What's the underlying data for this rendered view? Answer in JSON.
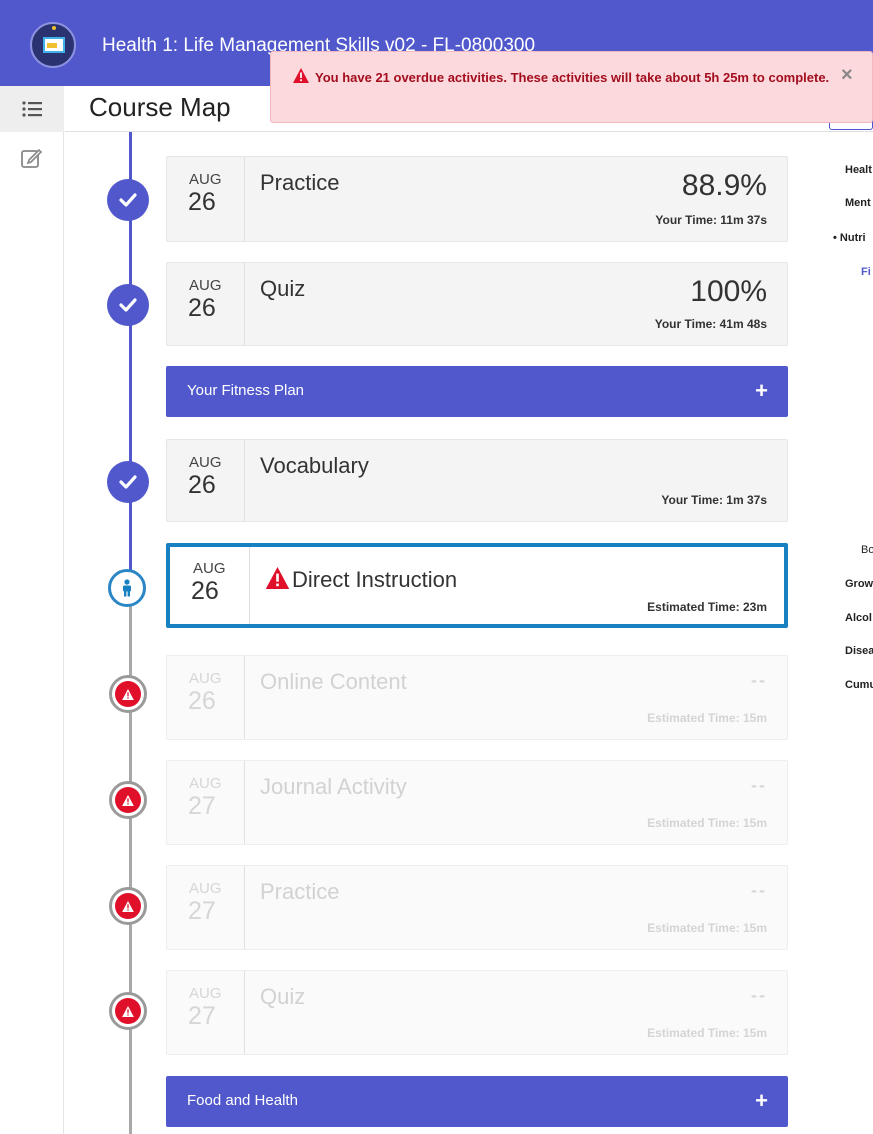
{
  "app": {
    "title": "Health 1: Life Management Skills v02 - FL-0800300"
  },
  "page": {
    "title": "Course Map"
  },
  "alert": {
    "message": "You have 21 overdue activities. These activities will take about 5h 25m to complete.",
    "close_label": "×"
  },
  "cards": [
    {
      "month": "AUG",
      "day": "26",
      "title": "Practice",
      "score": "88.9%",
      "time": "Your Time: 11m 37s",
      "status": "completed"
    },
    {
      "month": "AUG",
      "day": "26",
      "title": "Quiz",
      "score": "100%",
      "time": "Your Time: 41m 48s",
      "status": "completed"
    },
    {
      "month": "AUG",
      "day": "26",
      "title": "Vocabulary",
      "score": "",
      "time": "Your Time: 1m 37s",
      "status": "completed"
    },
    {
      "month": "AUG",
      "day": "26",
      "title": "Direct Instruction",
      "score": "",
      "time": "Estimated Time: 23m",
      "status": "current"
    },
    {
      "month": "AUG",
      "day": "26",
      "title": "Online Content",
      "score": "--",
      "time": "Estimated Time: 15m",
      "status": "overdue"
    },
    {
      "month": "AUG",
      "day": "27",
      "title": "Journal Activity",
      "score": "--",
      "time": "Estimated Time: 15m",
      "status": "overdue"
    },
    {
      "month": "AUG",
      "day": "27",
      "title": "Practice",
      "score": "--",
      "time": "Estimated Time: 15m",
      "status": "overdue"
    },
    {
      "month": "AUG",
      "day": "27",
      "title": "Quiz",
      "score": "--",
      "time": "Estimated Time: 15m",
      "status": "overdue"
    }
  ],
  "sections": [
    {
      "label": "Your Fitness Plan",
      "icon": "+"
    },
    {
      "label": "Food and Health",
      "icon": "+"
    }
  ],
  "right_panel": {
    "items": [
      "Healt",
      "Ment",
      "• Nutri",
      "Fi",
      "Bo",
      "Grow",
      "Alcol",
      "Disea",
      "Cumu"
    ]
  },
  "colors": {
    "brand": "#5058cc",
    "current": "#1680c0",
    "overdue": "#e0102a",
    "alert_bg": "#fcd9dd"
  },
  "icons": {
    "menu": "list-icon",
    "edit": "edit-icon",
    "done": "check-icon",
    "current": "person-icon",
    "overdue": "warning-icon"
  }
}
